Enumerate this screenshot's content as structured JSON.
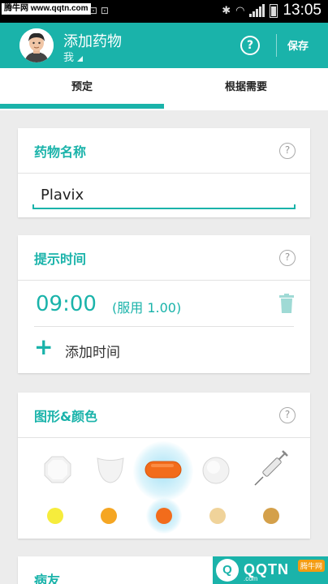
{
  "status_bar": {
    "watermark": "腾牛网 www.qqtn.com",
    "time": "13:05",
    "icons": [
      "bluetooth-icon",
      "wifi-icon",
      "signal-icon",
      "battery-icon"
    ]
  },
  "app_bar": {
    "title": "添加药物",
    "subtitle": "我",
    "help_icon": "?",
    "save_label": "保存",
    "color": "#1ab3aa"
  },
  "tabs": [
    {
      "label": "预定",
      "selected": true
    },
    {
      "label": "根据需要",
      "selected": false
    }
  ],
  "drug_name_card": {
    "title": "药物名称",
    "help_icon": "?",
    "value": "Plavix"
  },
  "reminder_card": {
    "title": "提示时间",
    "help_icon": "?",
    "time": "09:00",
    "dose": "(服用 1.00)",
    "add_icon": "+",
    "add_label": "添加时间"
  },
  "shape_color_card": {
    "title": "图形&颜色",
    "help_icon": "?",
    "shapes": [
      "round-tablet",
      "shield-tablet",
      "capsule",
      "round-pill",
      "syringe"
    ],
    "selected_shape": "capsule",
    "colors": [
      "#f6ec3c",
      "#f5a623",
      "#f26c1b",
      "#f0d39a",
      "#d4a04a"
    ],
    "selected_color": "#f26c1b"
  },
  "next_card": {
    "title": "病友"
  },
  "corner_logo": {
    "badge": "Q",
    "text": "QQTN",
    "sub": ".com",
    "tag": "腾牛网"
  }
}
